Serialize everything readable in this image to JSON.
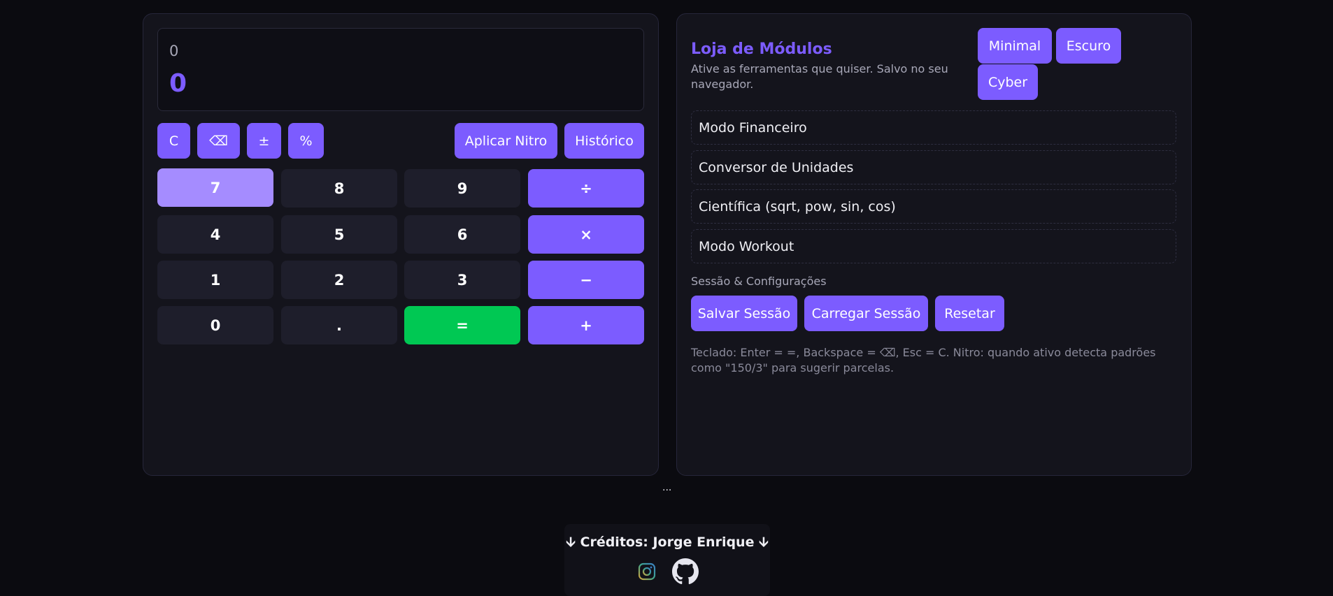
{
  "calculator": {
    "expression": "0",
    "result": "0",
    "controls": {
      "clear": "C",
      "backspace": "⌫",
      "toggle_sign": "±",
      "percent": "%",
      "nitro": "Aplicar Nitro",
      "history": "Histórico"
    },
    "keys": {
      "k7": "7",
      "k8": "8",
      "k9": "9",
      "divide": "÷",
      "k4": "4",
      "k5": "5",
      "k6": "6",
      "multiply": "×",
      "k1": "1",
      "k2": "2",
      "k3": "3",
      "minus": "−",
      "k0": "0",
      "dot": ".",
      "equals": "=",
      "plus": "+"
    }
  },
  "store": {
    "title": "Loja de Módulos",
    "subtitle": "Ative as ferramentas que quiser. Salvo no seu navegador.",
    "themes": {
      "minimal": "Minimal",
      "dark": "Escuro",
      "cyber": "Cyber"
    },
    "modules": [
      "Modo Financeiro",
      "Conversor de Unidades",
      "Científica (sqrt, pow, sin, cos)",
      "Modo Workout"
    ],
    "session_label": "Sessão & Configurações",
    "session_buttons": {
      "save": "Salvar Sessão",
      "load": "Carregar Sessão",
      "reset": "Resetar"
    },
    "help": "Teclado: Enter = =, Backspace = ⌫, Esc = C. Nitro: quando ativo detecta padrões como \"150/3\" para sugerir parcelas."
  },
  "ellipsis": "...",
  "footer": {
    "credits": "🡫 Créditos: Jorge Enrique 🡫",
    "icons": [
      "instagram-icon",
      "github-icon"
    ]
  },
  "colors": {
    "accent": "#7c5cff",
    "equals": "#00c853",
    "background": "#0b0b10",
    "panel": "#14141c"
  }
}
